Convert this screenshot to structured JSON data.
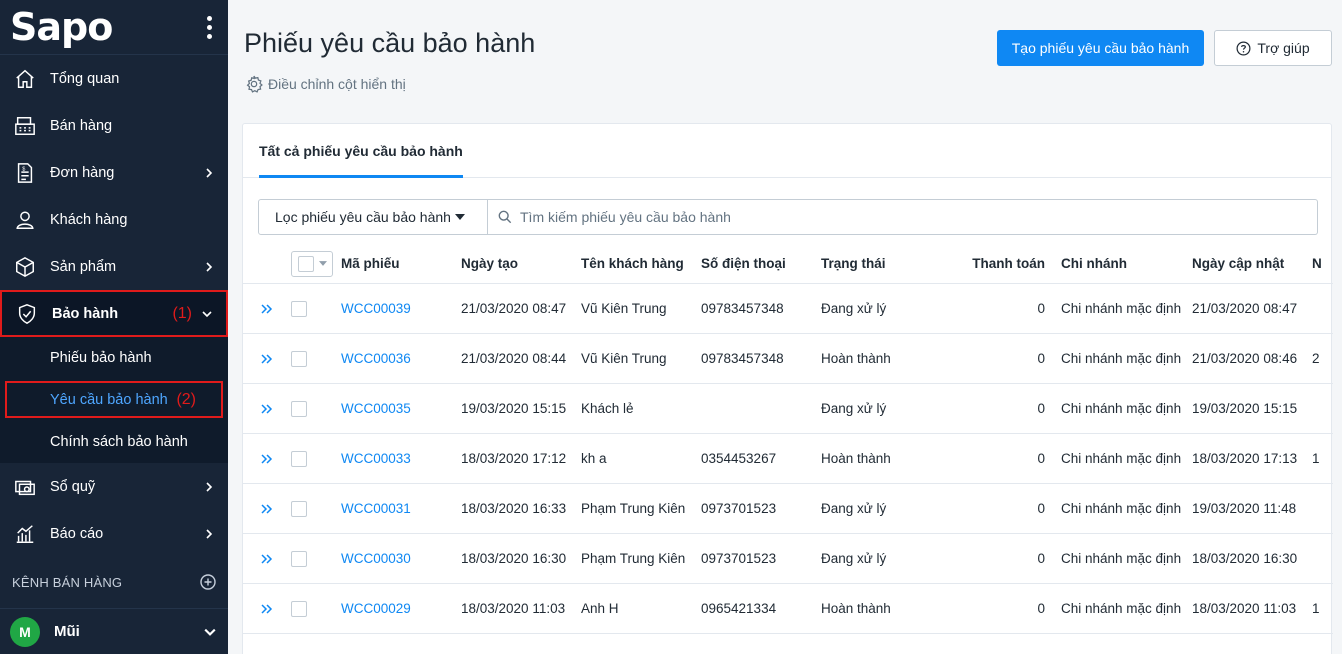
{
  "sidebar": {
    "logo": "Sapo",
    "items": [
      {
        "label": "Tổng quan",
        "icon": "home-icon",
        "has_chevron": false
      },
      {
        "label": "Bán hàng",
        "icon": "cash-register-icon",
        "has_chevron": false
      },
      {
        "label": "Đơn hàng",
        "icon": "order-document-icon",
        "has_chevron": true
      },
      {
        "label": "Khách hàng",
        "icon": "user-icon",
        "has_chevron": false
      },
      {
        "label": "Sản phẩm",
        "icon": "box-icon",
        "has_chevron": true
      },
      {
        "label": "Bảo hành",
        "icon": "shield-check-icon",
        "has_chevron": true,
        "annotation": "(1)"
      }
    ],
    "subitems": [
      {
        "label": "Phiếu bảo hành"
      },
      {
        "label": "Yêu cầu bảo hành",
        "annotation": "(2)"
      },
      {
        "label": "Chính sách bảo hành"
      }
    ],
    "items_after": [
      {
        "label": "Sổ quỹ",
        "icon": "cash-book-icon",
        "has_chevron": true
      },
      {
        "label": "Báo cáo",
        "icon": "report-chart-icon",
        "has_chevron": true
      }
    ],
    "channel_label": "KÊNH BÁN HÀNG",
    "user": {
      "initial": "M",
      "name": "Mũi"
    }
  },
  "header": {
    "title": "Phiếu yêu cầu bảo hành",
    "adjust_columns": "Điều chỉnh cột hiển thị",
    "primary_button": "Tạo phiếu yêu cầu bảo hành",
    "help_button": "Trợ giúp"
  },
  "tabs": [
    {
      "label": "Tất cả phiếu yêu cầu bảo hành"
    }
  ],
  "filter": {
    "dropdown_label": "Lọc phiếu yêu cầu bảo hành",
    "search_placeholder": "Tìm kiếm phiếu yêu cầu bảo hành"
  },
  "table": {
    "columns": [
      "Mã phiếu",
      "Ngày tạo",
      "Tên khách hàng",
      "Số điện thoại",
      "Trạng thái",
      "Thanh toán",
      "Chi nhánh",
      "Ngày cập nhật",
      "N"
    ],
    "rows": [
      {
        "code": "WCC00039",
        "created": "21/03/2020 08:47",
        "customer": "Vũ Kiên Trung",
        "phone": "09783457348",
        "status": "Đang xử lý",
        "payment": "0",
        "branch": "Chi nhánh mặc định",
        "updated": "21/03/2020 08:47",
        "more": ""
      },
      {
        "code": "WCC00036",
        "created": "21/03/2020 08:44",
        "customer": "Vũ Kiên Trung",
        "phone": "09783457348",
        "status": "Hoàn thành",
        "payment": "0",
        "branch": "Chi nhánh mặc định",
        "updated": "21/03/2020 08:46",
        "more": "2"
      },
      {
        "code": "WCC00035",
        "created": "19/03/2020 15:15",
        "customer": "Khách lẻ",
        "phone": "",
        "status": "Đang xử lý",
        "payment": "0",
        "branch": "Chi nhánh mặc định",
        "updated": "19/03/2020 15:15",
        "more": ""
      },
      {
        "code": "WCC00033",
        "created": "18/03/2020 17:12",
        "customer": "kh a",
        "phone": "0354453267",
        "status": "Hoàn thành",
        "payment": "0",
        "branch": "Chi nhánh mặc định",
        "updated": "18/03/2020 17:13",
        "more": "1"
      },
      {
        "code": "WCC00031",
        "created": "18/03/2020 16:33",
        "customer": "Phạm Trung Kiên",
        "phone": "0973701523",
        "status": "Đang xử lý",
        "payment": "0",
        "branch": "Chi nhánh mặc định",
        "updated": "19/03/2020 11:48",
        "more": ""
      },
      {
        "code": "WCC00030",
        "created": "18/03/2020 16:30",
        "customer": "Phạm Trung Kiên",
        "phone": "0973701523",
        "status": "Đang xử lý",
        "payment": "0",
        "branch": "Chi nhánh mặc định",
        "updated": "18/03/2020 16:30",
        "more": ""
      },
      {
        "code": "WCC00029",
        "created": "18/03/2020 11:03",
        "customer": "Anh H",
        "phone": "0965421334",
        "status": "Hoàn thành",
        "payment": "0",
        "branch": "Chi nhánh mặc định",
        "updated": "18/03/2020 11:03",
        "more": "1"
      }
    ]
  },
  "colors": {
    "sidebar": "#182537",
    "accent": "#0f88f3",
    "annotation_red": "#e01b1b",
    "active_sub": "#4ea6ff"
  }
}
